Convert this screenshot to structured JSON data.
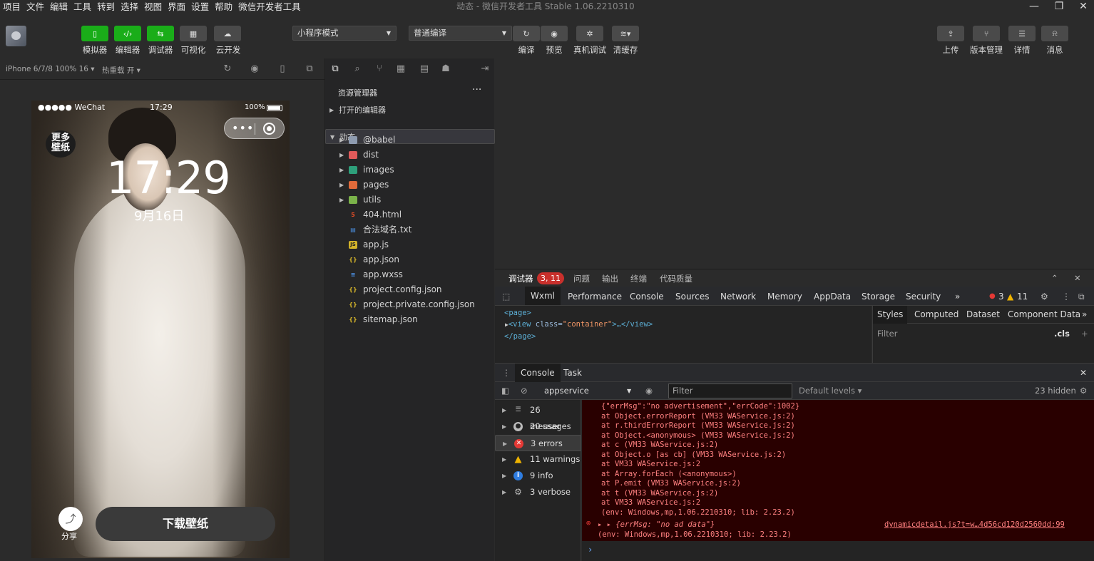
{
  "menubar": {
    "items": [
      "项目",
      "文件",
      "编辑",
      "工具",
      "转到",
      "选择",
      "视图",
      "界面",
      "设置",
      "帮助",
      "微信开发者工具"
    ],
    "window_title": "动态 - 微信开发者工具 Stable 1.06.2210310"
  },
  "toolbar": {
    "left_buttons": [
      {
        "label": "模拟器",
        "icon": "phone-icon"
      },
      {
        "label": "编辑器",
        "icon": "code-icon"
      },
      {
        "label": "调试器",
        "icon": "debug-icon"
      },
      {
        "label": "可视化",
        "icon": "layout-icon"
      },
      {
        "label": "云开发",
        "icon": "cloud-icon"
      }
    ],
    "mode_select": "小程序模式",
    "compile_select": "普通编译",
    "mid_buttons": [
      {
        "label": "编译",
        "icon": "refresh-icon"
      },
      {
        "label": "预览",
        "icon": "eye-icon"
      },
      {
        "label": "真机调试",
        "icon": "bug-icon"
      },
      {
        "label": "清缓存",
        "icon": "layers-icon"
      }
    ],
    "right_buttons": [
      {
        "label": "上传",
        "icon": "upload-icon"
      },
      {
        "label": "版本管理",
        "icon": "branch-icon"
      },
      {
        "label": "详情",
        "icon": "menu-icon"
      },
      {
        "label": "消息",
        "icon": "bell-icon"
      }
    ]
  },
  "simulator": {
    "device": "iPhone 6/7/8 100% 16 ▾",
    "hot_reload": "热重载 开 ▾",
    "status": {
      "carrier": "●●●●● WeChat",
      "time": "17:29",
      "battery": "100%"
    },
    "more_badge": "更多\n壁纸",
    "big_time": "17:29",
    "date": "9月16日",
    "share_label": "分享",
    "download_button": "下载壁纸"
  },
  "explorer": {
    "title": "资源管理器",
    "more": "···",
    "sections": [
      {
        "label": "打开的编辑器",
        "expanded": false
      },
      {
        "label": "动态",
        "expanded": true
      }
    ],
    "items": [
      {
        "name": "@babel",
        "type": "folder",
        "color": "#8e9bb0"
      },
      {
        "name": "dist",
        "type": "folder",
        "color": "#e05a5a"
      },
      {
        "name": "images",
        "type": "folder",
        "color": "#2ea07b"
      },
      {
        "name": "pages",
        "type": "folder",
        "color": "#e06a3a"
      },
      {
        "name": "utils",
        "type": "folder",
        "color": "#7bb34a"
      },
      {
        "name": "404.html",
        "type": "file",
        "icon": "html-icon",
        "color": "#e44d26"
      },
      {
        "name": "合法域名.txt",
        "type": "file",
        "icon": "txt-icon",
        "color": "#4a8ee0"
      },
      {
        "name": "app.js",
        "type": "file",
        "icon": "js-icon",
        "color": "#d4b42a"
      },
      {
        "name": "app.json",
        "type": "file",
        "icon": "json-icon",
        "color": "#d4b42a"
      },
      {
        "name": "app.wxss",
        "type": "file",
        "icon": "wxss-icon",
        "color": "#4a8ee0"
      },
      {
        "name": "project.config.json",
        "type": "file",
        "icon": "json-icon",
        "color": "#d4b42a"
      },
      {
        "name": "project.private.config.json",
        "type": "file",
        "icon": "json-icon",
        "color": "#d4b42a"
      },
      {
        "name": "sitemap.json",
        "type": "file",
        "icon": "json-icon",
        "color": "#d4b42a"
      }
    ]
  },
  "devtools": {
    "top_tabs": [
      "调试器",
      "问题",
      "输出",
      "终端",
      "代码质量"
    ],
    "top_badge": "3, 11",
    "tabs": [
      "Wxml",
      "Performance",
      "Console",
      "Sources",
      "Network",
      "Memory",
      "AppData",
      "Storage",
      "Security",
      "»"
    ],
    "error_count": "3",
    "warning_count": "11",
    "wxml": {
      "line1": "<page>",
      "line2_tag": "<view",
      "line2_attr": " class=",
      "line2_val": "\"container\"",
      "line2_rest": ">…</view>",
      "line3": "</page>"
    },
    "styles_tabs": [
      "Styles",
      "Computed",
      "Dataset",
      "Component Data",
      "»"
    ],
    "styles_filter": "Filter",
    "styles_cls": ".cls",
    "console_tabs": [
      "Console",
      "Task"
    ],
    "context": "appservice",
    "filter_placeholder": "Filter",
    "levels": "Default levels ▾",
    "hidden": "23 hidden",
    "sidebar": [
      {
        "label": "26 messages",
        "icon": "list-icon",
        "color": "#bbb"
      },
      {
        "label": "20 user mes...",
        "icon": "user-icon",
        "color": "#bbb"
      },
      {
        "label": "3 errors",
        "icon": "error-icon",
        "color": "#e53935"
      },
      {
        "label": "11 warnings",
        "icon": "warning-icon",
        "color": "#f0b400"
      },
      {
        "label": "9 info",
        "icon": "info-icon",
        "color": "#2f7de1"
      },
      {
        "label": "3 verbose",
        "icon": "gear-icon",
        "color": "#bbb"
      }
    ],
    "error_lines": [
      "{\"errMsg\":\"no advertisement\",\"errCode\":1002}",
      "    at Object.errorReport (VM33 WAService.js:2)",
      "    at r.thirdErrorReport (VM33 WAService.js:2)",
      "    at Object.<anonymous> (VM33 WAService.js:2)",
      "    at c (VM33 WAService.js:2)",
      "    at Object.o [as cb] (VM33 WAService.js:2)",
      "    at VM33 WAService.js:2",
      "    at Array.forEach (<anonymous>)",
      "    at P.emit (VM33 WAService.js:2)",
      "    at t (VM33 WAService.js:2)",
      "    at VM33 WAService.js:2",
      "(env: Windows,mp,1.06.2210310; lib: 2.23.2)"
    ],
    "error2": {
      "msg": "▸ ▸ {errMsg: \"no ad data\"}",
      "source": "dynamicdetail.js?t=w…4d56cd120d2560dd:99",
      "env": "(env: Windows,mp,1.06.2210310; lib: 2.23.2)"
    },
    "prompt": "›"
  }
}
